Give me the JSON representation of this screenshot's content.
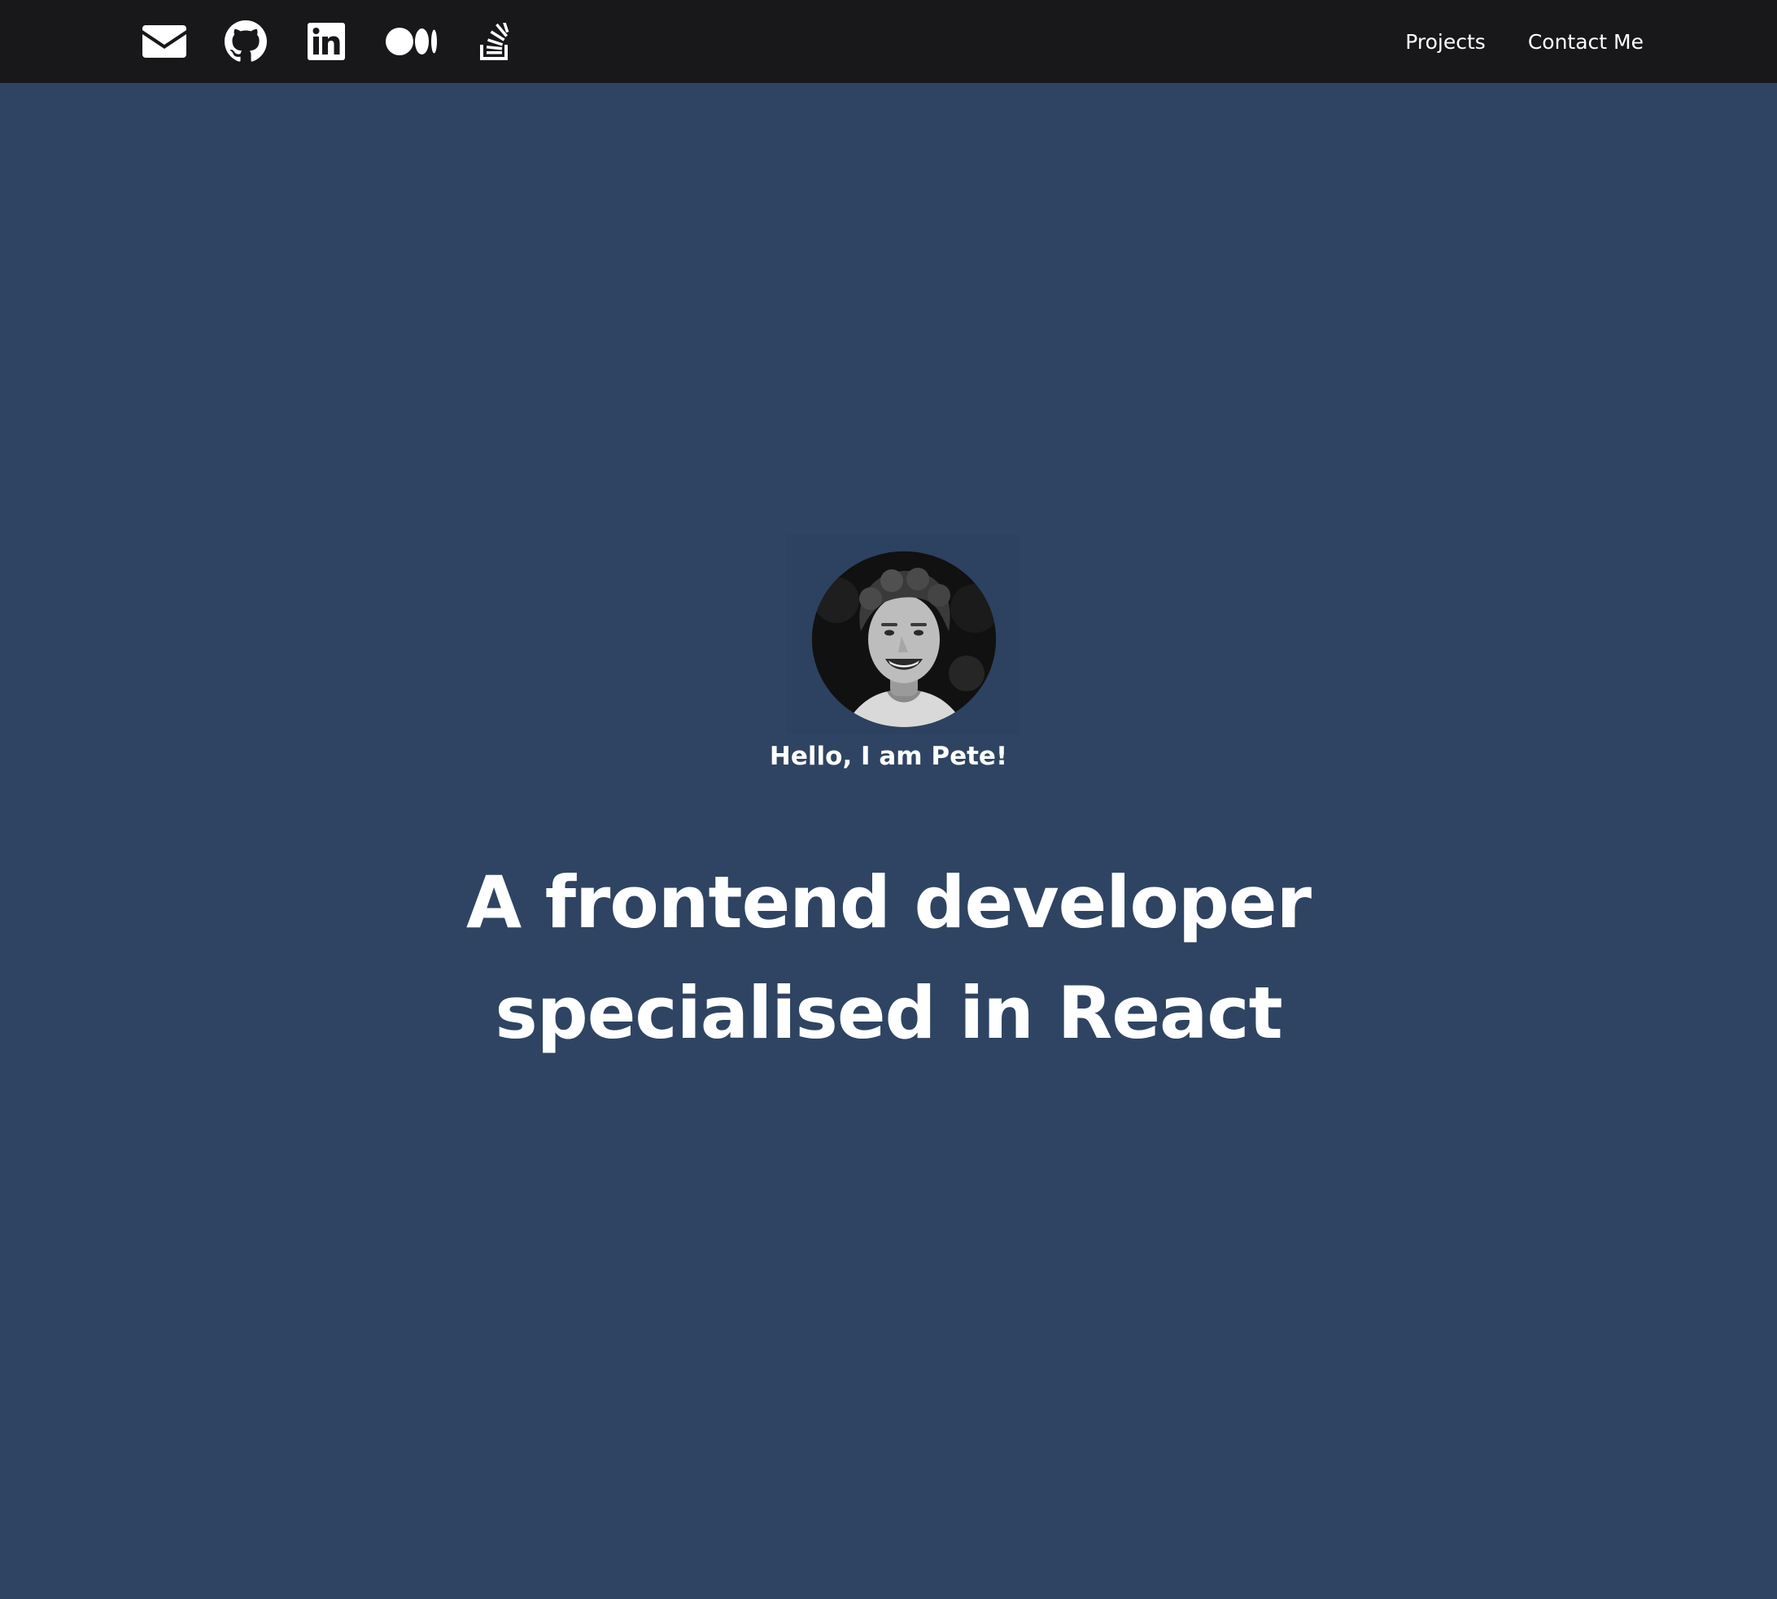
{
  "header": {
    "socials": [
      {
        "name": "envelope-icon"
      },
      {
        "name": "github-icon"
      },
      {
        "name": "linkedin-icon"
      },
      {
        "name": "medium-icon"
      },
      {
        "name": "stackoverflow-icon"
      }
    ],
    "nav": {
      "projects_label": "Projects",
      "contact_label": "Contact Me"
    }
  },
  "hero": {
    "greeting": "Hello, I am Pete!",
    "headline_line1": "A frontend developer",
    "headline_line2": "specialised in React",
    "avatar_icon": "profile-photo"
  },
  "colors": {
    "header_bg": "#18181b",
    "hero_bg": "#2f4462",
    "text": "#ffffff"
  }
}
